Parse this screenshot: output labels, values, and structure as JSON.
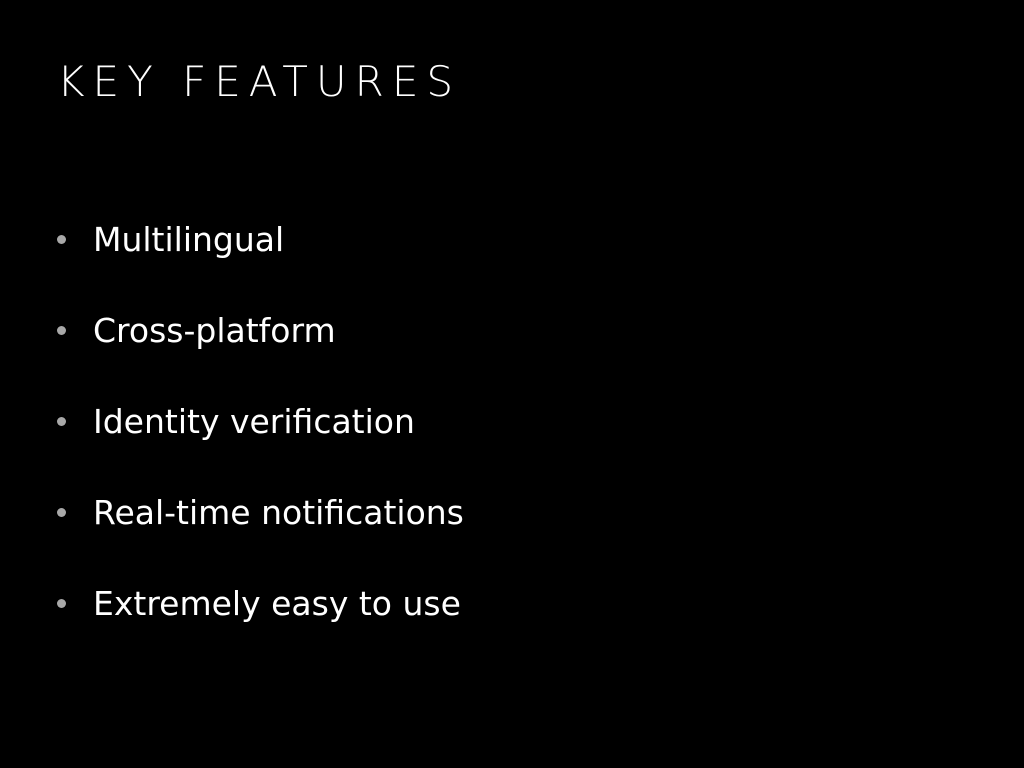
{
  "slide": {
    "title": "KEY FEATURES",
    "bullet_color": "#a8a8a8",
    "background": "#000000",
    "text_color": "#ffffff",
    "bullets": [
      "Multilingual",
      "Cross-platform",
      "Identity verification",
      "Real-time notifications",
      "Extremely easy to use"
    ]
  }
}
